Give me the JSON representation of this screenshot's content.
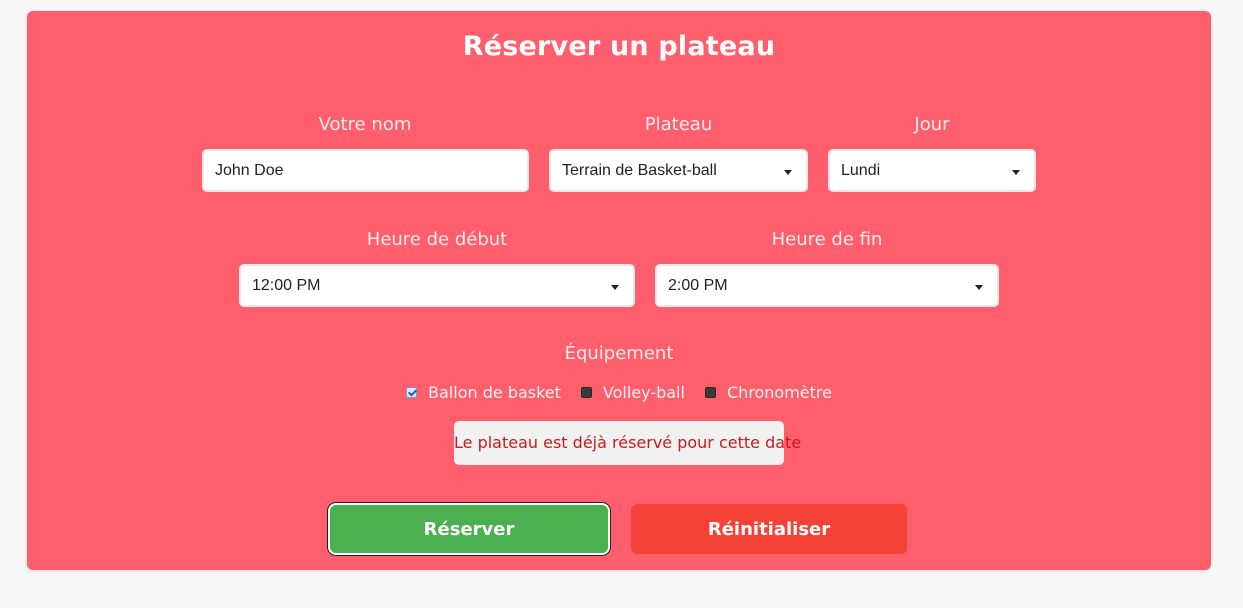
{
  "form": {
    "title": "Réserver un plateau",
    "name_label": "Votre nom",
    "name_value": "John Doe",
    "plateau_label": "Plateau",
    "plateau_value": "Terrain de Basket-ball",
    "day_label": "Jour",
    "day_value": "Lundi",
    "start_label": "Heure de début",
    "start_value": "12:00 PM",
    "end_label": "Heure de fin",
    "end_value": "2:00 PM",
    "equipment_label": "Équipement",
    "equipment": [
      {
        "label": "Ballon de basket",
        "checked": true
      },
      {
        "label": "Volley-ball",
        "checked": false
      },
      {
        "label": "Chronomètre",
        "checked": false
      }
    ],
    "error_message": "Le plateau est déjà réservé pour cette date",
    "submit_label": "Réserver",
    "reset_label": "Réinitialiser"
  },
  "colors": {
    "card_background": "#ff5f6d",
    "submit_button": "#4caf50",
    "reset_button": "#f44336",
    "error_text": "#c81a1a"
  }
}
